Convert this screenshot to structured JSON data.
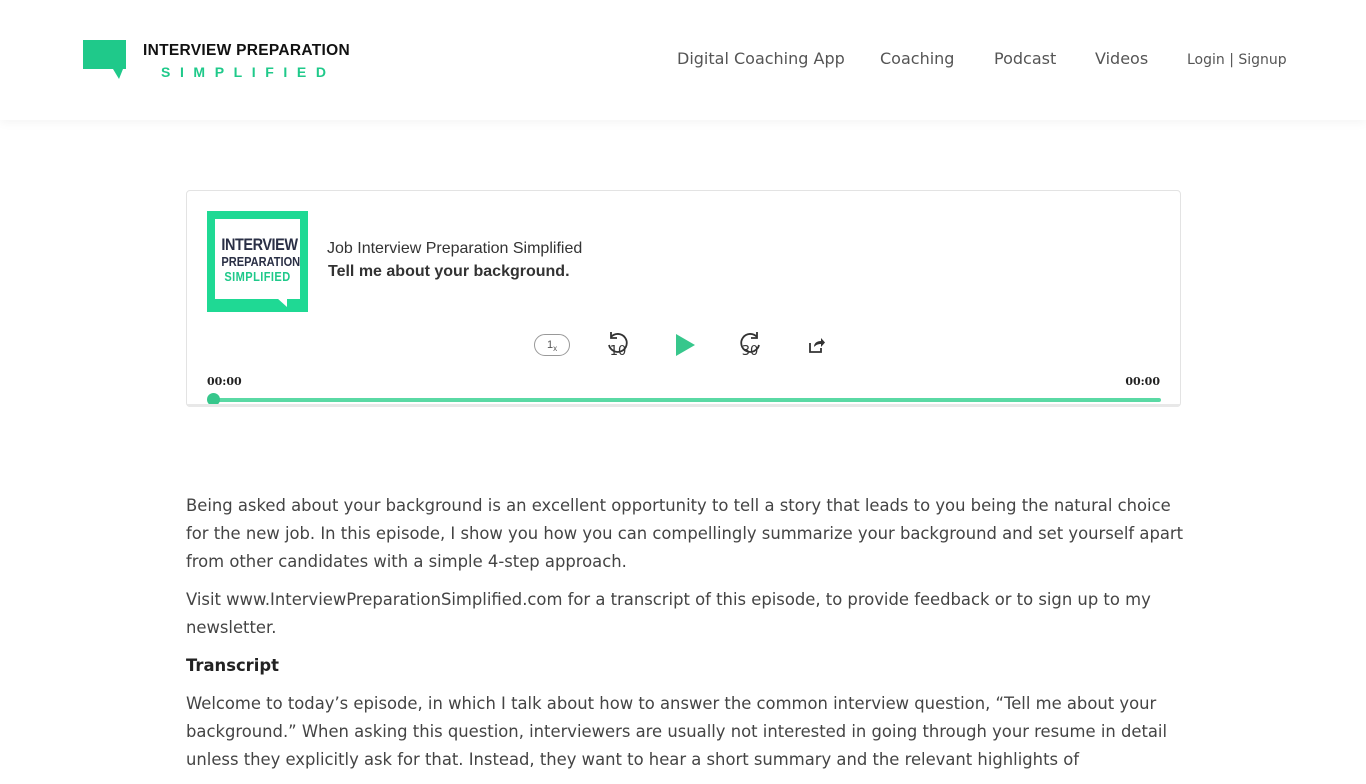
{
  "brand": {
    "line1": "INTERVIEW PREPARATION",
    "line2": "SIMPLIFIED",
    "accent_color": "#1fc98a",
    "icon": "speech-bubble-icon"
  },
  "nav": {
    "items": [
      {
        "label": "Digital Coaching App"
      },
      {
        "label": "Coaching"
      },
      {
        "label": "Podcast"
      },
      {
        "label": "Videos"
      }
    ],
    "login_label": "Login | Signup"
  },
  "player": {
    "cover": {
      "line1": "INTERVIEW",
      "line2": "PREPARATION",
      "line3": "SIMPLIFIED"
    },
    "show_title": "Job Interview Preparation Simplified",
    "episode_title": "Tell me about your background.",
    "speed_label": "1",
    "speed_suffix": "x",
    "rewind_label": "10",
    "forward_label": "30",
    "time_current": "00:00",
    "time_total": "00:00",
    "progress": 0,
    "accent_color": "#37c78c"
  },
  "article": {
    "intro": "Being asked about your background is an excellent opportunity to tell a story that leads to you being the natural choice for the new job. In this episode, I show you how you can compellingly summarize your background and set yourself apart from other candidates with a simple 4-step approach.",
    "visit": "Visit www.InterviewPreparationSimplified.com for a transcript of this episode, to provide feedback or to sign up to my newsletter.",
    "transcript_heading": "Transcript",
    "transcript_body": "Welcome to today’s episode, in which I talk about how to answer the common interview question, “Tell me about your background.” When asking this question, interviewers are usually not interested in going through your resume in detail unless they explicitly ask for that. Instead, they want to hear a short summary and the relevant highlights of"
  }
}
